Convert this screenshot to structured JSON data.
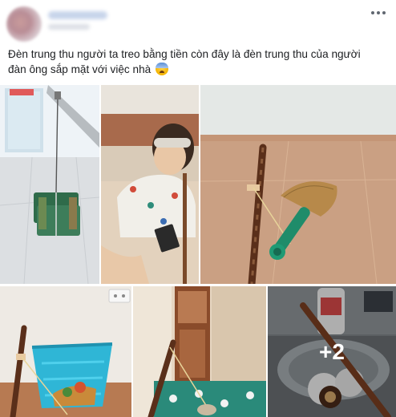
{
  "post": {
    "author": {
      "avatar_icon": "profile-avatar-icon"
    },
    "more_icon": "ellipsis-icon",
    "text_line1": "Đèn trung thu người ta treo bằng tiền còn đây là đèn trung thu của người",
    "text_line2": "đàn ông sắp mặt với việc nhà",
    "emoji_icon": "anxious-face-emoji-icon"
  },
  "photos": {
    "count_visible": 5,
    "more_label": "+2"
  },
  "colors": {
    "text": "#1c1e21",
    "secondary": "#606770",
    "overlay_text": "#ffffff"
  }
}
